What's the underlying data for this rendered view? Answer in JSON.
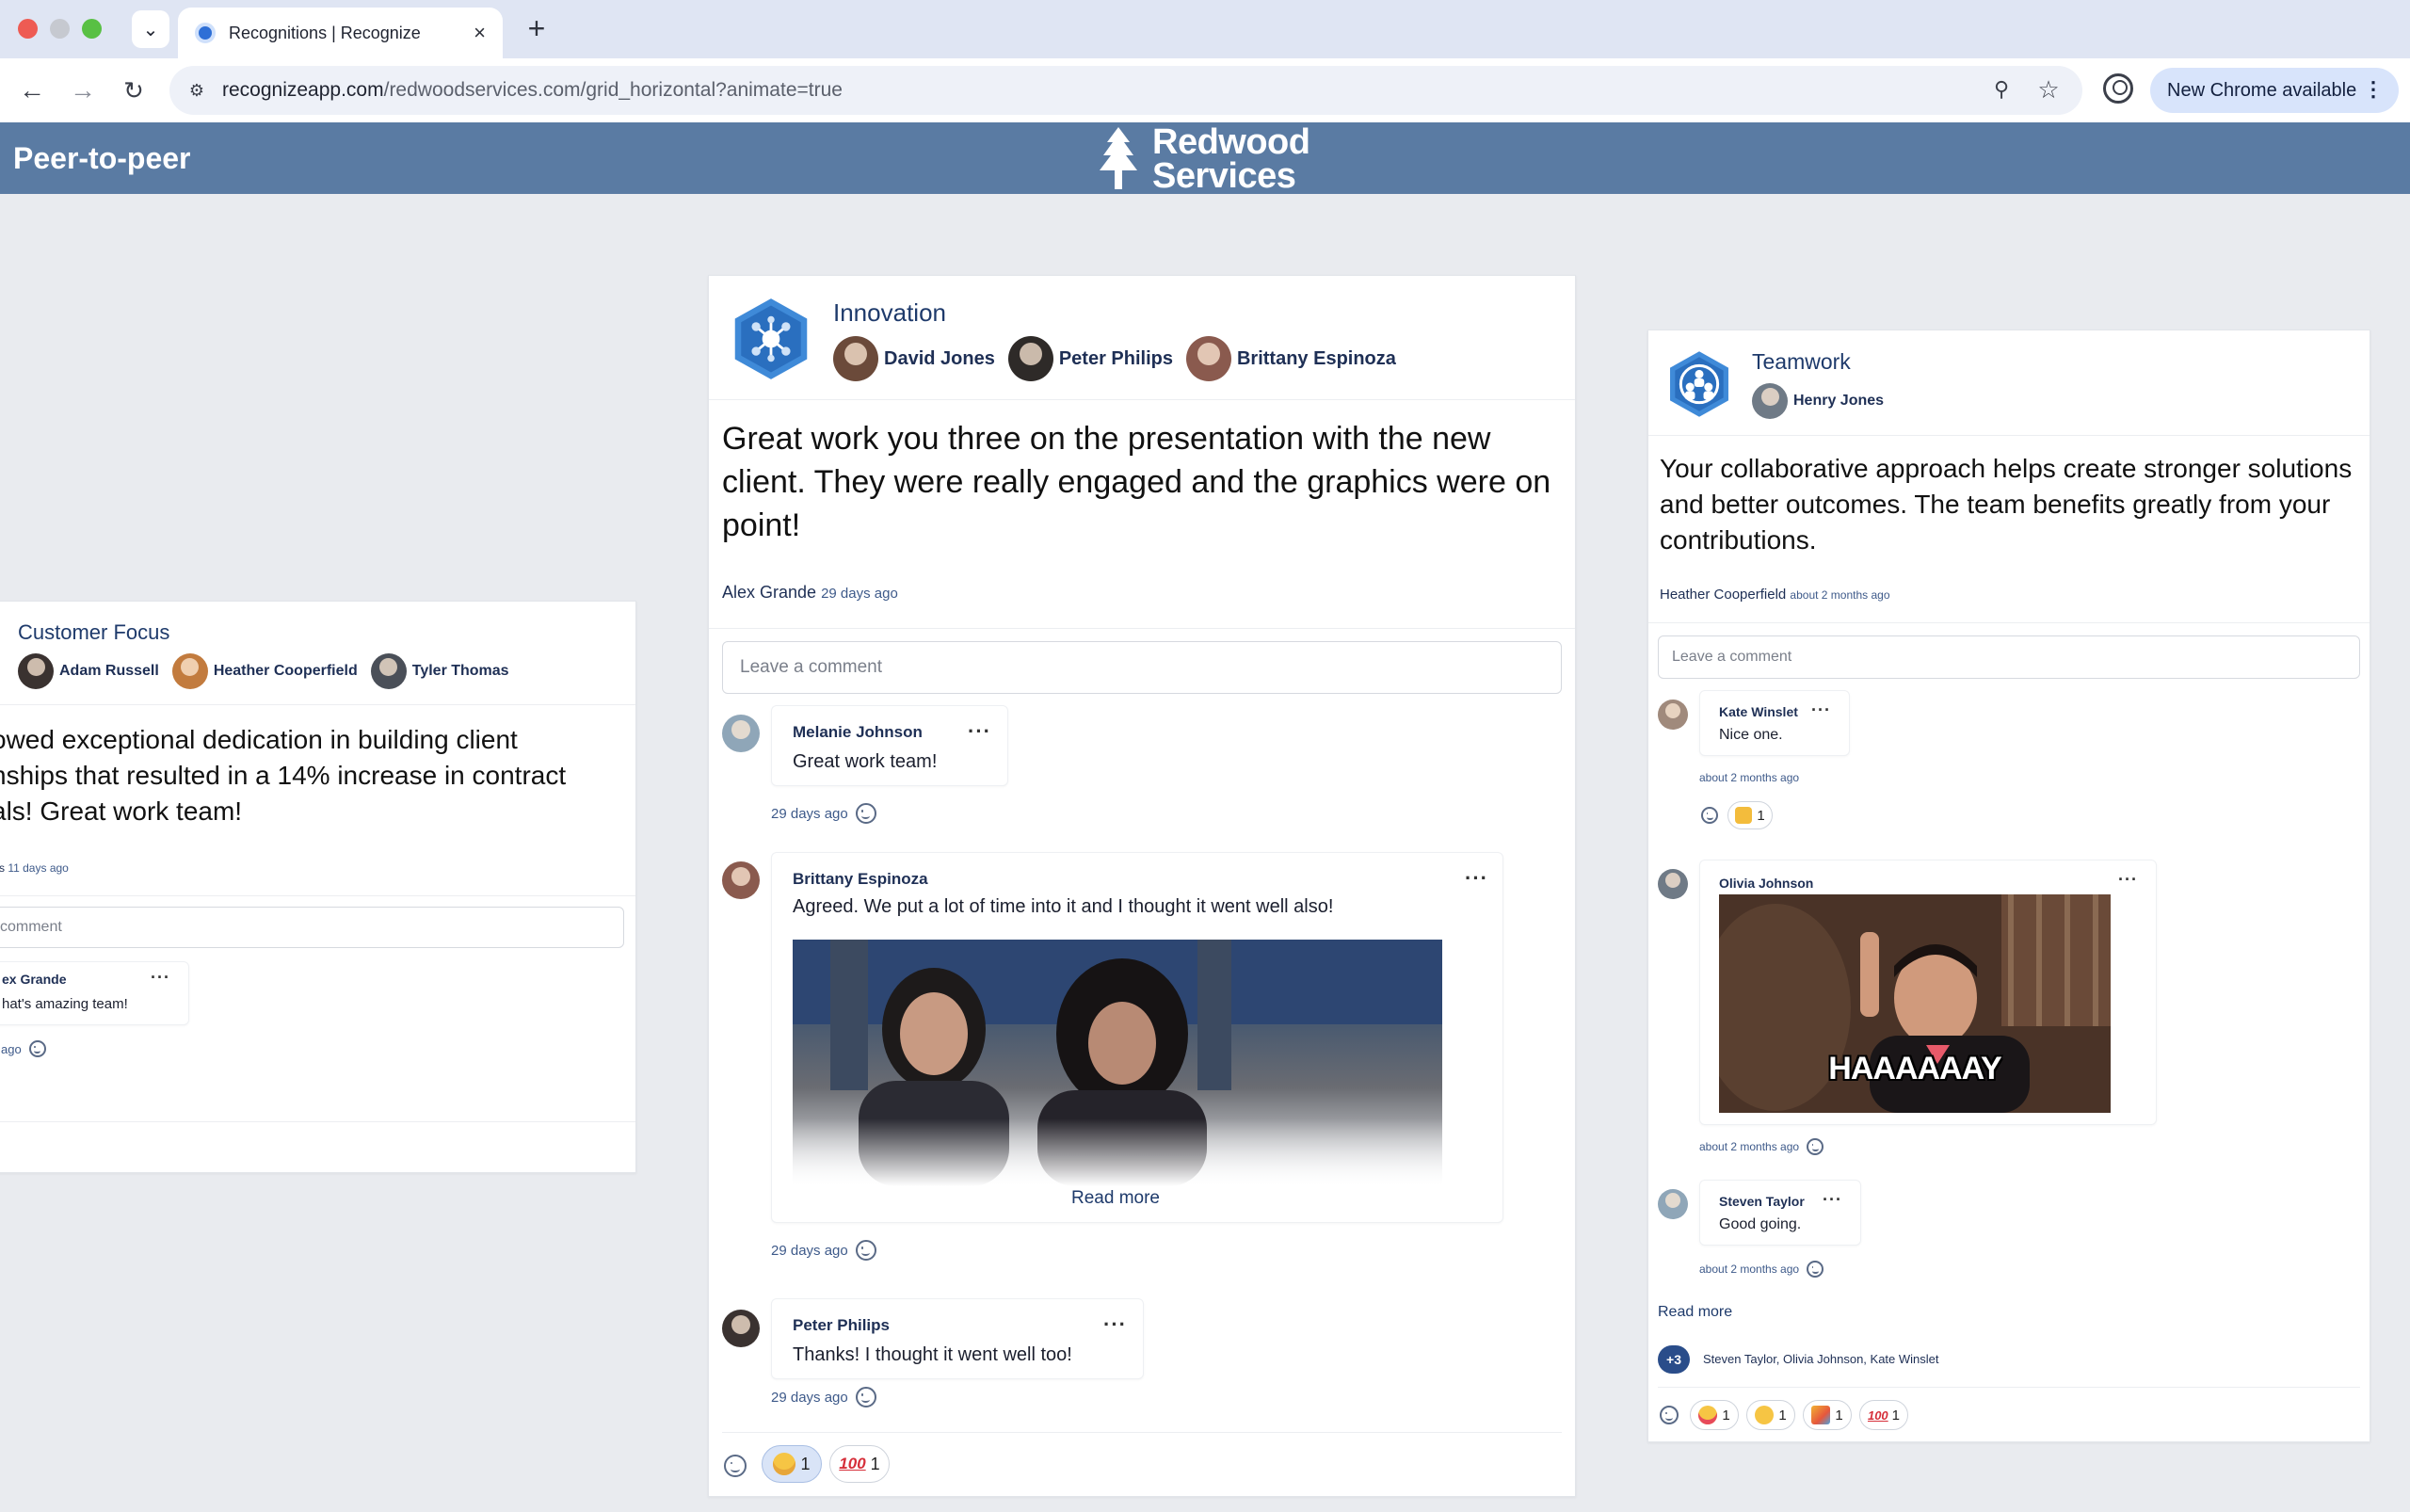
{
  "browser": {
    "tab_title": "Recognitions | Recognize",
    "url_host": "recognizeapp.com",
    "url_path": "/redwoodservices.com/grid_horizontal?animate=true",
    "update_label": "New Chrome available"
  },
  "header": {
    "title": "Peer-to-peer",
    "logo_line1": "Redwood",
    "logo_line2": "Services",
    "bg_color": "#5a7ba3"
  },
  "cards": {
    "left": {
      "value": "Customer Focus",
      "recipients": [
        "Adam Russell",
        "Heather Cooperfield",
        "Tyler Thomas"
      ],
      "message_lines": [
        "owed exceptional dedication in building client",
        "nships that resulted in a 14% increase in contract",
        "als! Great work team!"
      ],
      "giver_fragment": "s",
      "ago": "11 days ago",
      "comment_placeholder": "comment",
      "comment": {
        "author": "ex Grande",
        "text": "hat's amazing team!",
        "ago": "ago"
      }
    },
    "center": {
      "value": "Innovation",
      "recipients": [
        "David Jones",
        "Peter Philips",
        "Brittany Espinoza"
      ],
      "message": "Great work you three on the presentation with the new client. They were really engaged and the graphics were on point!",
      "giver": "Alex Grande",
      "ago": "29 days ago",
      "comment_placeholder": "Leave a comment",
      "comments": [
        {
          "author": "Melanie Johnson",
          "text": "Great work team!",
          "ago": "29 days ago"
        },
        {
          "author": "Brittany Espinoza",
          "text": "Agreed. We put a lot of time into it and I thought it went well also!",
          "ago": "29 days ago",
          "read_more": "Read more"
        },
        {
          "author": "Peter Philips",
          "text": "Thanks! I thought it went well too!",
          "ago": "29 days ago"
        }
      ],
      "reactions": [
        {
          "emoji": "heart-eyes",
          "count": "1"
        },
        {
          "emoji": "hundred",
          "count": "1"
        }
      ]
    },
    "right": {
      "value": "Teamwork",
      "recipients": [
        "Henry Jones"
      ],
      "message": "Your collaborative approach helps create stronger solutions and better outcomes. The team benefits greatly from your contributions.",
      "giver": "Heather Cooperfield",
      "ago": "about 2 months ago",
      "comment_placeholder": "Leave a comment",
      "comments": [
        {
          "author": "Kate Winslet",
          "text": "Nice one.",
          "ago": "about 2 months ago",
          "reaction_count": "1"
        },
        {
          "author": "Olivia Johnson",
          "gif_text": "HAAAAAAY",
          "ago": "about 2 months ago"
        },
        {
          "author": "Steven Taylor",
          "text": "Good going.",
          "ago": "about 2 months ago"
        }
      ],
      "read_more": "Read more",
      "more_count": "+3",
      "reactors": "Steven Taylor, Olivia Johnson, Kate Winslet",
      "reactions": [
        {
          "emoji": "heart-eyes",
          "count": "1"
        },
        {
          "emoji": "wink",
          "count": "1"
        },
        {
          "emoji": "party-popper",
          "count": "1"
        },
        {
          "emoji": "hundred",
          "count": "1"
        }
      ]
    }
  }
}
